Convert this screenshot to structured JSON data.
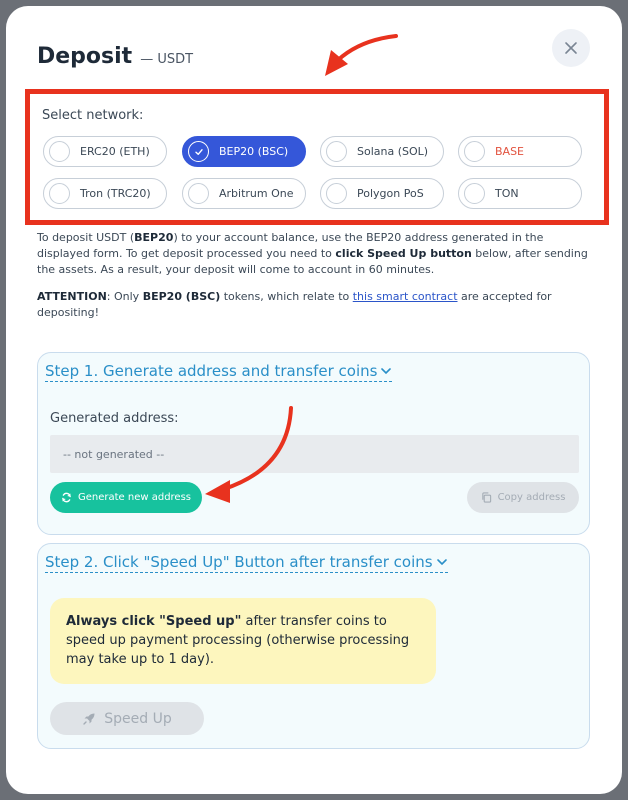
{
  "header": {
    "title": "Deposit",
    "subtitle": "— USDT"
  },
  "network": {
    "label": "Select network:",
    "options": [
      {
        "label": "ERC20 (ETH)",
        "selected": false
      },
      {
        "label": "BEP20 (BSC)",
        "selected": true
      },
      {
        "label": "Solana (SOL)",
        "selected": false
      },
      {
        "label": "BASE",
        "selected": false
      },
      {
        "label": "Tron (TRC20)",
        "selected": false
      },
      {
        "label": "Arbitrum One",
        "selected": false
      },
      {
        "label": "Polygon PoS",
        "selected": false
      },
      {
        "label": "TON",
        "selected": false
      }
    ]
  },
  "info": {
    "t1": "To deposit USDT (",
    "t2": "BEP20",
    "t3": ") to your account balance, use the BEP20 address generated in the displayed form. To get deposit processed you need to ",
    "t4": "click Speed Up button",
    "t5": " below, after sending the assets. As a result, your deposit will come to account in 60 minutes."
  },
  "attention": {
    "label": "ATTENTION",
    "t1": ": Only ",
    "t2": "BEP20 (BSC)",
    "t3": " tokens, which relate to ",
    "link": "this smart contract",
    "t4": " are accepted for depositing!"
  },
  "step1": {
    "title": "Step 1. Generate address and transfer coins",
    "address_label": "Generated address:",
    "address_value": "-- not generated --",
    "generate_button": "Generate new address",
    "copy_button": "Copy address"
  },
  "step2": {
    "title": "Step 2. Click \"Speed Up\" Button after transfer coins",
    "note_bold": "Always click \"Speed up\"",
    "note_rest": " after transfer coins to speed up payment processing (otherwise processing may take up to 1 day).",
    "speed_button": "Speed Up"
  },
  "colors": {
    "accent": "#3557d9",
    "highlight_box": "#e8321e",
    "generate_green": "#17c29e",
    "step_title": "#2a8fc8",
    "note_bg": "#fdf6be"
  },
  "icons": {
    "close": "close-icon",
    "check": "check-icon",
    "chevron": "chevron-down-icon",
    "refresh": "refresh-icon",
    "copy": "copy-icon",
    "rocket": "rocket-icon"
  }
}
